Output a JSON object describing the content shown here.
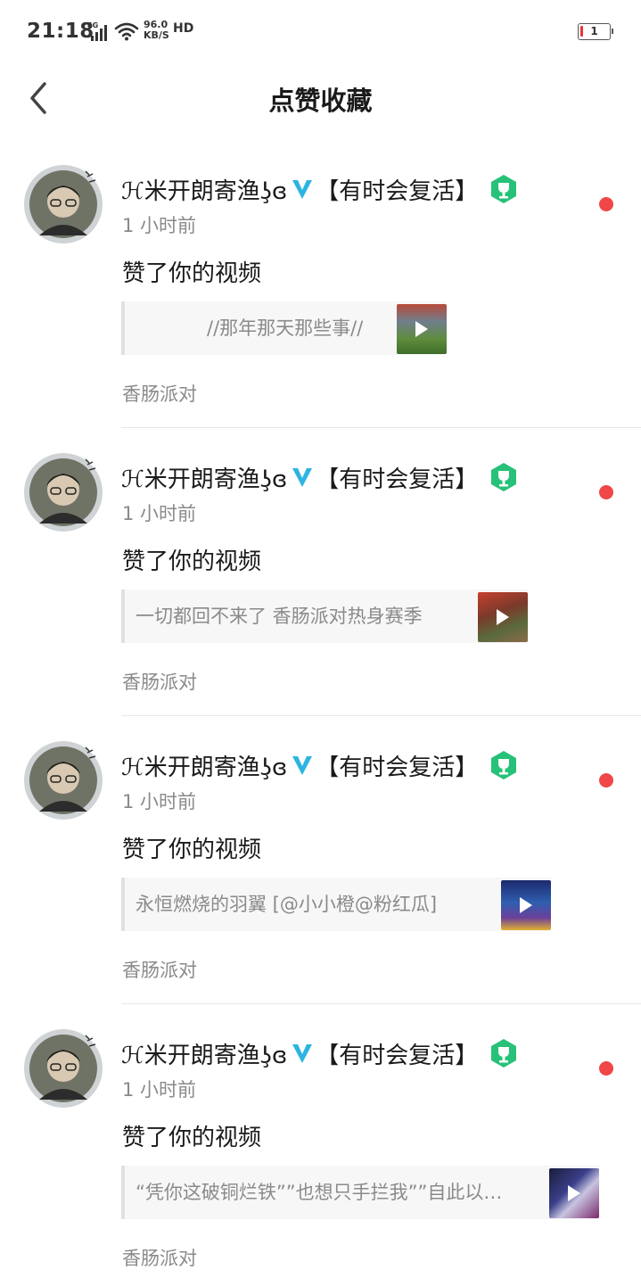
{
  "status_bar": {
    "time": "21:18",
    "network_type": "4G",
    "speed_value": "96.0",
    "speed_unit": "KB/S",
    "hd_label": "HD",
    "battery_level": "1",
    "battery_color": "#e53935"
  },
  "header": {
    "back_icon": "chevron-left-icon",
    "title": "点赞收藏"
  },
  "accent_colors": {
    "unread_dot": "#f04747",
    "verified_badge": "#2bb5e0",
    "trophy_badge": "#27c178"
  },
  "notifications": [
    {
      "username": "ℋ米开朗寄渔ʖ̧ɞ",
      "verified_icon": "verified-v-icon",
      "tagline": "【有时会复活】",
      "badge_icon": "trophy-icon",
      "time": "1 小时前",
      "action": "赞了你的视频",
      "video_title": "//那年那天那些事//",
      "source": "香肠派对",
      "unread": true
    },
    {
      "username": "ℋ米开朗寄渔ʖ̧ɞ",
      "verified_icon": "verified-v-icon",
      "tagline": "【有时会复活】",
      "badge_icon": "trophy-icon",
      "time": "1 小时前",
      "action": "赞了你的视频",
      "video_title": "一切都回不来了  香肠派对热身赛季",
      "source": "香肠派对",
      "unread": true
    },
    {
      "username": "ℋ米开朗寄渔ʖ̧ɞ",
      "verified_icon": "verified-v-icon",
      "tagline": "【有时会复活】",
      "badge_icon": "trophy-icon",
      "time": "1 小时前",
      "action": "赞了你的视频",
      "video_title": "永恒燃烧的羽翼    [@小小橙@粉红瓜]",
      "source": "香肠派对",
      "unread": true
    },
    {
      "username": "ℋ米开朗寄渔ʖ̧ɞ",
      "verified_icon": "verified-v-icon",
      "tagline": "【有时会复活】",
      "badge_icon": "trophy-icon",
      "time": "1 小时前",
      "action": "赞了你的视频",
      "video_title": "“凭你这破铜烂铁””也想只手拦我””自此以…",
      "source": "香肠派对",
      "unread": true
    }
  ]
}
